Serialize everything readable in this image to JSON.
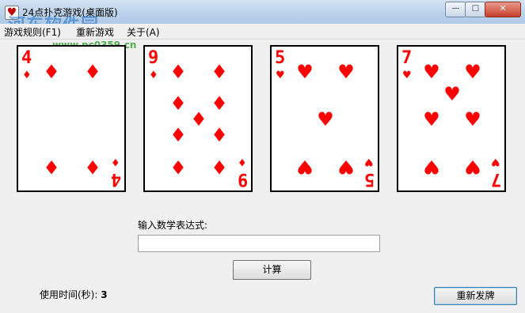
{
  "window": {
    "title": "24点扑克游戏(桌面版)",
    "app_icon": "card-app-icon",
    "controls": {
      "minimize": "—",
      "maximize": "□",
      "close": "✕"
    }
  },
  "watermark": {
    "text": "河东软件园",
    "url": "www.pc0359.cn"
  },
  "menu": [
    {
      "label": "游戏规则(F1)"
    },
    {
      "label": "重新游戏"
    },
    {
      "label": "关于(A)"
    }
  ],
  "cards": [
    {
      "rank": "4",
      "suit": "diamonds",
      "symbol": "♦",
      "color": "#ff0000"
    },
    {
      "rank": "9",
      "suit": "diamonds",
      "symbol": "♦",
      "color": "#ff0000"
    },
    {
      "rank": "5",
      "suit": "hearts",
      "symbol": "♥",
      "color": "#ff0000"
    },
    {
      "rank": "7",
      "suit": "hearts",
      "symbol": "♥",
      "color": "#ff0000"
    }
  ],
  "expression": {
    "label": "输入数学表达式:",
    "value": "",
    "placeholder": ""
  },
  "buttons": {
    "calculate": "计算",
    "redeal": "重新发牌"
  },
  "timer": {
    "label": "使用时间(秒):",
    "value": "3"
  }
}
